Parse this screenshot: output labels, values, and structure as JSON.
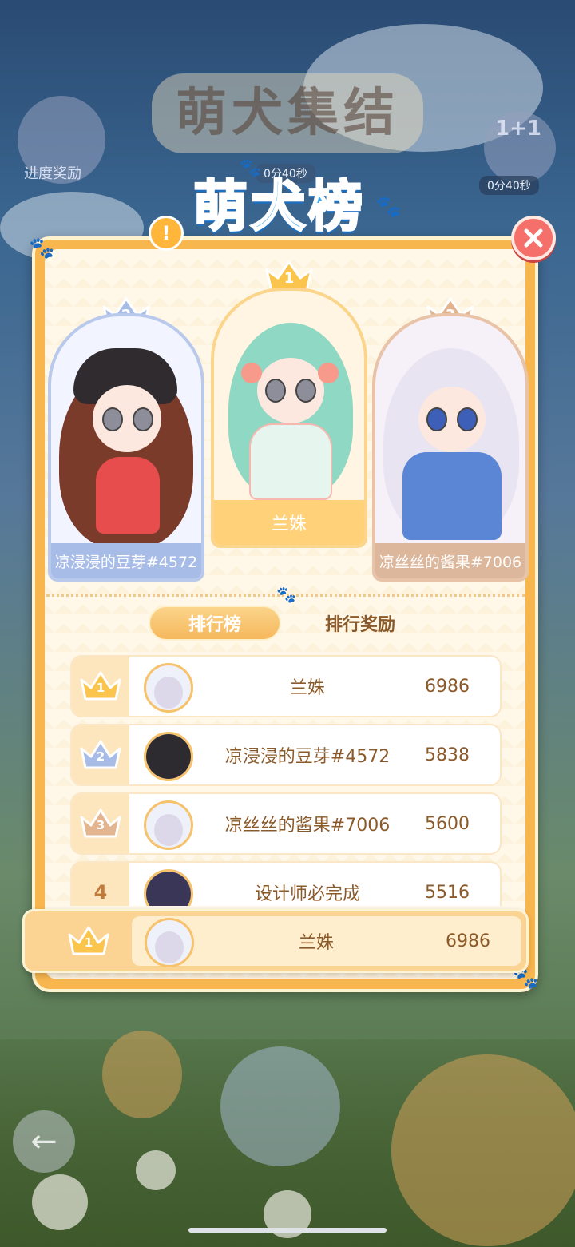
{
  "background": {
    "event_title": "萌犬集结",
    "progress_reward_label": "进度奖励",
    "timer_left": "0分40秒",
    "timer_right": "0分40秒",
    "bonus_badge": "1+1"
  },
  "modal": {
    "title": "萌犬榜",
    "title_badge": "!",
    "podium": [
      {
        "rank": "2",
        "name": "凉浸浸的豆芽#4572"
      },
      {
        "rank": "1",
        "name": "兰姝"
      },
      {
        "rank": "3",
        "name": "凉丝丝的酱果#7006"
      }
    ],
    "tabs": {
      "active": "排行榜",
      "inactive": "排行奖励"
    },
    "leaderboard": [
      {
        "rank": "1",
        "name": "兰姝",
        "score": "6986"
      },
      {
        "rank": "2",
        "name": "凉浸浸的豆芽#4572",
        "score": "5838"
      },
      {
        "rank": "3",
        "name": "凉丝丝的酱果#7006",
        "score": "5600"
      },
      {
        "rank": "4",
        "name": "设计师必完成",
        "score": "5516"
      }
    ],
    "my_entry": {
      "rank": "1",
      "name": "兰姝",
      "score": "6986"
    }
  },
  "colors": {
    "gold": "#f8b64f",
    "silver": "#a8bce8",
    "bronze": "#dcb79b",
    "text_brown": "#8b5a2a",
    "close_red": "#f5706a"
  }
}
